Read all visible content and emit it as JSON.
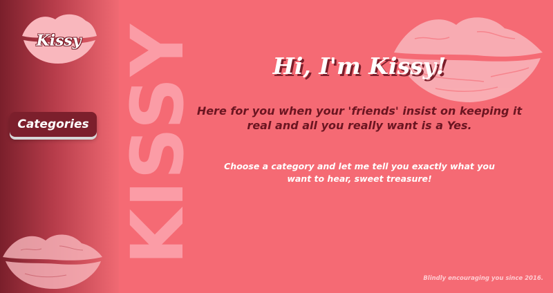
{
  "brand": {
    "logo_text": "Kissy",
    "watermark_text": "KISSY"
  },
  "sidebar": {
    "categories_label": "Categories"
  },
  "main": {
    "title": "Hi, I'm Kissy!",
    "tagline": "Here for you when your 'friends' insist on keeping it real and all you really want is a Yes.",
    "subline": "Choose a category and let me tell you exactly what you want to hear, sweet treasure!"
  },
  "footer": {
    "text": "Blindly encouraging you since 2016."
  },
  "colors": {
    "background": "#f56a74",
    "sidebar_dark": "#7a1f2b",
    "accent_dark": "#6b1521",
    "lips_light": "#f9b7bd",
    "text_light": "#ffffff"
  }
}
